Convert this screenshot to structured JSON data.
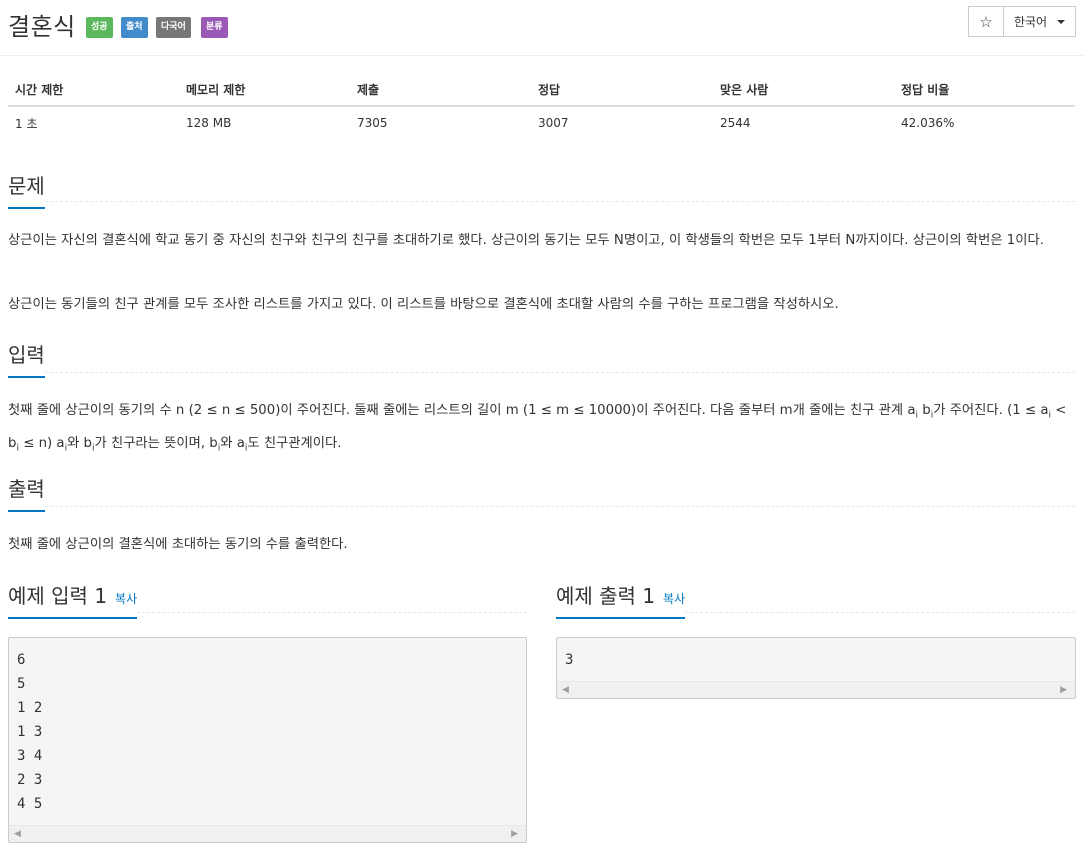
{
  "header": {
    "title": "결혼식",
    "labels": [
      {
        "text": "성공",
        "color": "#5cb85c"
      },
      {
        "text": "출처",
        "color": "#428bca"
      },
      {
        "text": "다국어",
        "color": "#777777"
      },
      {
        "text": "분류",
        "color": "#9b59b6"
      }
    ],
    "star_icon": "☆",
    "language": "한국어"
  },
  "info_table": {
    "headers": [
      "시간 제한",
      "메모리 제한",
      "제출",
      "정답",
      "맞은 사람",
      "정답 비율"
    ],
    "values": [
      "1 초",
      "128 MB",
      "7305",
      "3007",
      "2544",
      "42.036%"
    ]
  },
  "problem": {
    "heading": "문제",
    "p1": "상근이는 자신의 결혼식에 학교 동기 중 자신의 친구와 친구의 친구를 초대하기로 했다. 상근이의 동기는 모두 N명이고, 이 학생들의 학번은 모두 1부터 N까지이다. 상근이의 학번은 1이다.",
    "p2": "상근이는 동기들의 친구 관계를 모두 조사한 리스트를 가지고 있다. 이 리스트를 바탕으로 결혼식에 초대할 사람의 수를 구하는 프로그램을 작성하시오."
  },
  "input": {
    "heading": "입력",
    "t1": "첫째 줄에 상근이의 동기의 수 n (2 ≤ n ≤ 500)이 주어진다. 둘째 줄에는 리스트의 길이 m (1 ≤ m ≤ 10000)이 주어진다. 다음 줄부터 m개 줄에는 친구 관계 a",
    "t2": " b",
    "t3": "가 주어진다. (1 ≤ a",
    "t4": " < b",
    "t5": " ≤ n) a",
    "t6": "와 b",
    "t7": "가 친구라는 뜻이며, b",
    "t8": "와 a",
    "t9": "도 친구관계이다.",
    "sub": "i"
  },
  "output": {
    "heading": "출력",
    "text": "첫째 줄에 상근이의 결혼식에 초대하는 동기의 수를 출력한다."
  },
  "sample_input": {
    "heading": "예제 입력 1",
    "copy": "복사",
    "lines": [
      "6",
      "5",
      "1 2",
      "1 3",
      "3 4",
      "2 3",
      "4 5"
    ]
  },
  "sample_output": {
    "heading": "예제 출력 1",
    "copy": "복사",
    "lines": [
      "3"
    ]
  },
  "icons": {
    "scroll_left": "◀",
    "scroll_right": "▶"
  }
}
